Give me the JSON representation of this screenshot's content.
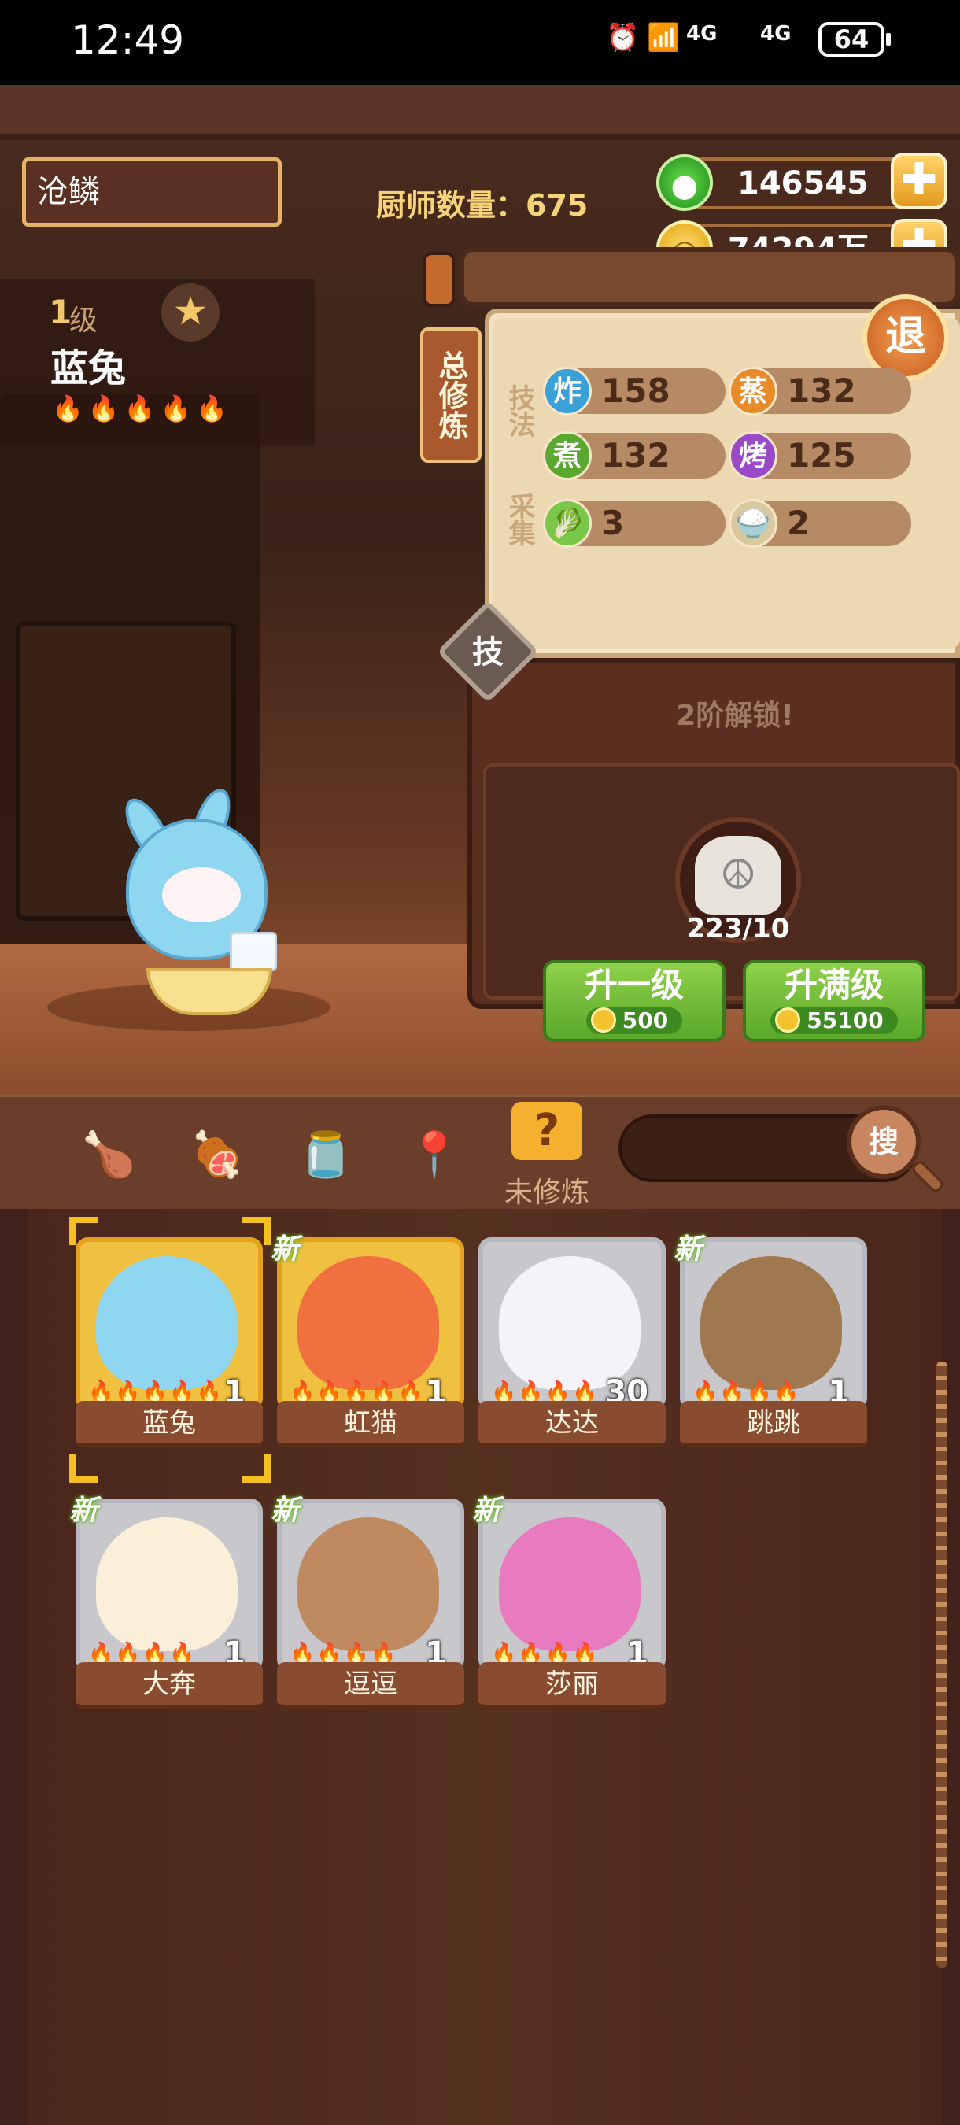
{
  "status_bar": {
    "time": "12:49",
    "signal1": "4G",
    "signal2": "4G",
    "battery": "64"
  },
  "player": {
    "name": "沧鳞"
  },
  "chef_count": "厨师数量：675",
  "currency": {
    "jade": "146545",
    "coins": "74294万",
    "plus_label": "✚"
  },
  "selected_chef": {
    "level_num": "1",
    "level_unit": "级",
    "name": "蓝兔",
    "flames": "🔥🔥🔥🔥🔥"
  },
  "total_training_label": "总修炼",
  "quit_label": "退",
  "stats": {
    "technique_label": "技法",
    "gather_label": "采集",
    "items": [
      {
        "icon": "炸",
        "value": "158",
        "color": "#3aa0d8"
      },
      {
        "icon": "蒸",
        "value": "132",
        "color": "#e88a2a"
      },
      {
        "icon": "煮",
        "value": "132",
        "color": "#5aa830"
      },
      {
        "icon": "烤",
        "value": "125",
        "color": "#9a4ac8"
      },
      {
        "icon": "🥬",
        "value": "3",
        "color": "#7ac84a"
      },
      {
        "icon": "🍚",
        "value": "2",
        "color": "#d8c8a0"
      }
    ]
  },
  "skill_label": "技",
  "unlock_text": "2阶解锁!",
  "token": {
    "count": "223/10",
    "glyph": "☮"
  },
  "upgrade": {
    "one": {
      "title": "升一级",
      "cost": "500"
    },
    "max": {
      "title": "升满级",
      "cost": "55100"
    }
  },
  "tabs": {
    "icons": [
      "🍗",
      "🍖",
      "🫙",
      "📍"
    ],
    "untrained_icon": "?",
    "untrained_label": "未修炼",
    "search_label": "搜"
  },
  "new_label": "新",
  "chefs": [
    {
      "name": "蓝兔",
      "level": "1",
      "flames": "🔥🔥🔥🔥🔥",
      "new": "",
      "gold": true,
      "color": "#8fd6f0"
    },
    {
      "name": "虹猫",
      "level": "1",
      "flames": "🔥🔥🔥🔥🔥",
      "new": "新",
      "gold": true,
      "color": "#f07040"
    },
    {
      "name": "达达",
      "level": "30",
      "flames": "🔥🔥🔥🔥",
      "new": "",
      "gold": false,
      "color": "#f4f4f8"
    },
    {
      "name": "跳跳",
      "level": "1",
      "flames": "🔥🔥🔥🔥",
      "new": "新",
      "gold": false,
      "color": "#a07850"
    },
    {
      "name": "大奔",
      "level": "1",
      "flames": "🔥🔥🔥🔥",
      "new": "新",
      "gold": false,
      "color": "#fbefd8"
    },
    {
      "name": "逗逗",
      "level": "1",
      "flames": "🔥🔥🔥🔥",
      "new": "新",
      "gold": false,
      "color": "#c08a60"
    },
    {
      "name": "莎丽",
      "level": "1",
      "flames": "🔥🔥🔥🔥",
      "new": "新",
      "gold": false,
      "color": "#e87ac0"
    }
  ]
}
